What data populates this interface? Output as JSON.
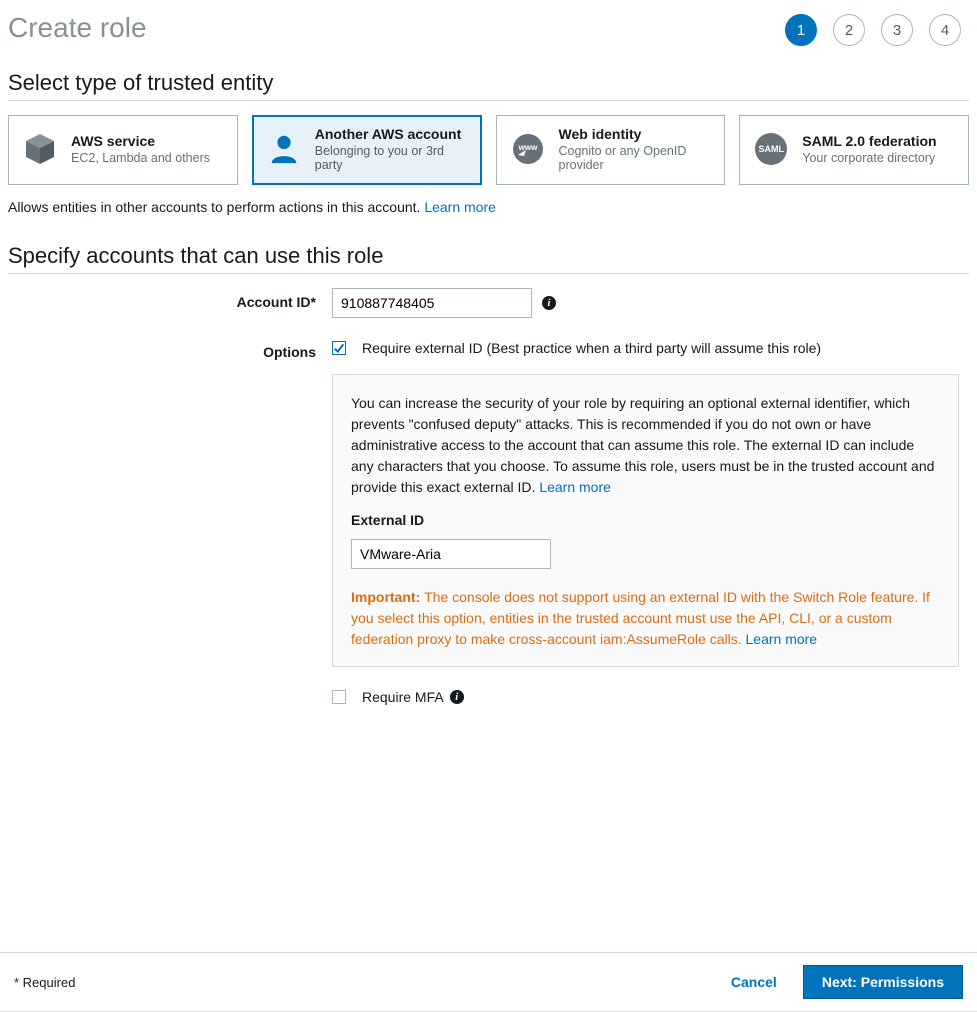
{
  "header": {
    "title": "Create role",
    "steps": [
      "1",
      "2",
      "3",
      "4"
    ],
    "activeStep": 0
  },
  "section1": {
    "title": "Select type of trusted entity"
  },
  "entities": [
    {
      "title": "AWS service",
      "subtitle": "EC2, Lambda and others",
      "selected": false,
      "icon": "box"
    },
    {
      "title": "Another AWS account",
      "subtitle": "Belonging to you or 3rd party",
      "selected": true,
      "icon": "user"
    },
    {
      "title": "Web identity",
      "subtitle": "Cognito or any OpenID provider",
      "selected": false,
      "icon": "www"
    },
    {
      "title": "SAML 2.0 federation",
      "subtitle": "Your corporate directory",
      "selected": false,
      "icon": "saml"
    }
  ],
  "description": {
    "text": "Allows entities in other accounts to perform actions in this account. ",
    "learnMore": "Learn more"
  },
  "section2": {
    "title": "Specify accounts that can use this role"
  },
  "accountId": {
    "label": "Account ID*",
    "value": "910887748405"
  },
  "options": {
    "label": "Options",
    "requireExternalId": {
      "checked": true,
      "text": "Require external ID (Best practice when a third party will assume this role)"
    },
    "panel": {
      "body": "You can increase the security of your role by requiring an optional external identifier, which prevents \"confused deputy\" attacks. This is recommended if you do not own or have administrative access to the account that can assume this role. The external ID can include any characters that you choose. To assume this role, users must be in the trusted account and provide this exact external ID. ",
      "learnMore": "Learn more",
      "externalIdLabel": "External ID",
      "externalIdValue": "VMware-Aria",
      "importantPrefix": "Important: ",
      "importantBody": "The console does not support using an external ID with the Switch Role feature. If you select this option, entities in the trusted account must use the API, CLI, or a custom federation proxy to make cross-account iam:AssumeRole calls. ",
      "importantLearnMore": "Learn more"
    },
    "requireMfa": {
      "checked": false,
      "text": "Require MFA"
    }
  },
  "footer": {
    "requiredNote": "* Required",
    "cancel": "Cancel",
    "next": "Next: Permissions"
  }
}
